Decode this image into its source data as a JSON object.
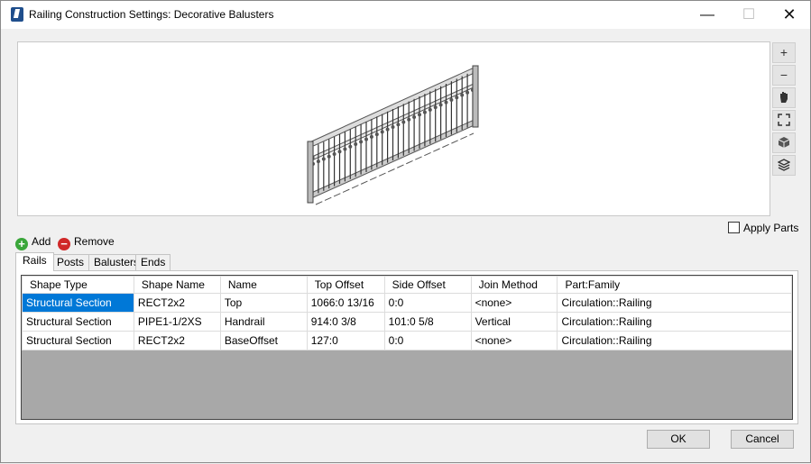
{
  "window": {
    "title": "Railing Construction Settings: Decorative Balusters",
    "minimize": "—",
    "maximize": "☐",
    "close": "✕"
  },
  "view_toolbar": {
    "zoom_in": "+",
    "zoom_out": "−"
  },
  "apply_parts_label": "Apply Parts",
  "apply_parts_checked": false,
  "actions": {
    "add_label": "Add",
    "remove_label": "Remove"
  },
  "tabs": [
    {
      "label": "Rails",
      "active": true
    },
    {
      "label": "Posts",
      "active": false
    },
    {
      "label": "Balusters",
      "active": false
    },
    {
      "label": "Ends",
      "active": false
    }
  ],
  "grid": {
    "columns": [
      "Shape Type",
      "Shape Name",
      "Name",
      "Top Offset",
      "Side Offset",
      "Join Method",
      "Part:Family"
    ],
    "rows": [
      [
        "Structural Section",
        "RECT2x2",
        "Top",
        "1066:0 13/16",
        "0:0",
        "<none>",
        "Circulation::Railing"
      ],
      [
        "Structural Section",
        "PIPE1-1/2XS",
        "Handrail",
        "914:0 3/8",
        "101:0 5/8",
        "Vertical",
        "Circulation::Railing"
      ],
      [
        "Structural Section",
        "RECT2x2",
        "BaseOffset",
        "127:0",
        "0:0",
        "<none>",
        "Circulation::Railing"
      ]
    ]
  },
  "buttons": {
    "ok": "OK",
    "cancel": "Cancel"
  },
  "colors": {
    "selection": "#0078d7",
    "add_icon": "#3aa63a",
    "remove_icon": "#d02828"
  }
}
